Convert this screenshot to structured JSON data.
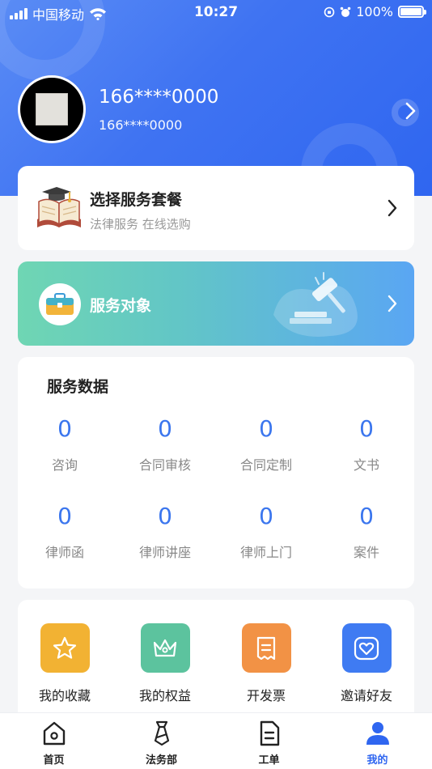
{
  "status_bar": {
    "carrier": "中国移动",
    "time": "10:27",
    "battery": "100%"
  },
  "profile": {
    "name": "166****0000",
    "phone": "166****0000"
  },
  "package_card": {
    "title": "选择服务套餐",
    "subtitle": "法律服务 在线选购"
  },
  "target_card": {
    "title": "服务对象"
  },
  "stats": {
    "title": "服务数据",
    "items": [
      {
        "value": "0",
        "label": "咨询"
      },
      {
        "value": "0",
        "label": "合同审核"
      },
      {
        "value": "0",
        "label": "合同定制"
      },
      {
        "value": "0",
        "label": "文书"
      },
      {
        "value": "0",
        "label": "律师函"
      },
      {
        "value": "0",
        "label": "律师讲座"
      },
      {
        "value": "0",
        "label": "律师上门"
      },
      {
        "value": "0",
        "label": "案件"
      }
    ]
  },
  "tools": [
    {
      "label": "我的收藏",
      "icon": "star-icon",
      "color": "#f2b233"
    },
    {
      "label": "我的权益",
      "icon": "crown-icon",
      "color": "#5cc39e"
    },
    {
      "label": "开发票",
      "icon": "receipt-icon",
      "color": "#f29245"
    },
    {
      "label": "邀请好友",
      "icon": "heart-icon",
      "color": "#3f7bf2"
    }
  ],
  "tabbar": {
    "items": [
      {
        "label": "首页",
        "icon": "home-icon"
      },
      {
        "label": "法务部",
        "icon": "tie-icon"
      },
      {
        "label": "工单",
        "icon": "document-icon"
      },
      {
        "label": "我的",
        "icon": "user-icon"
      }
    ],
    "active_index": 3,
    "active_color": "#2f66f0"
  },
  "colors": {
    "hero": "#3f73f2",
    "stat_number": "#3b76ee"
  }
}
